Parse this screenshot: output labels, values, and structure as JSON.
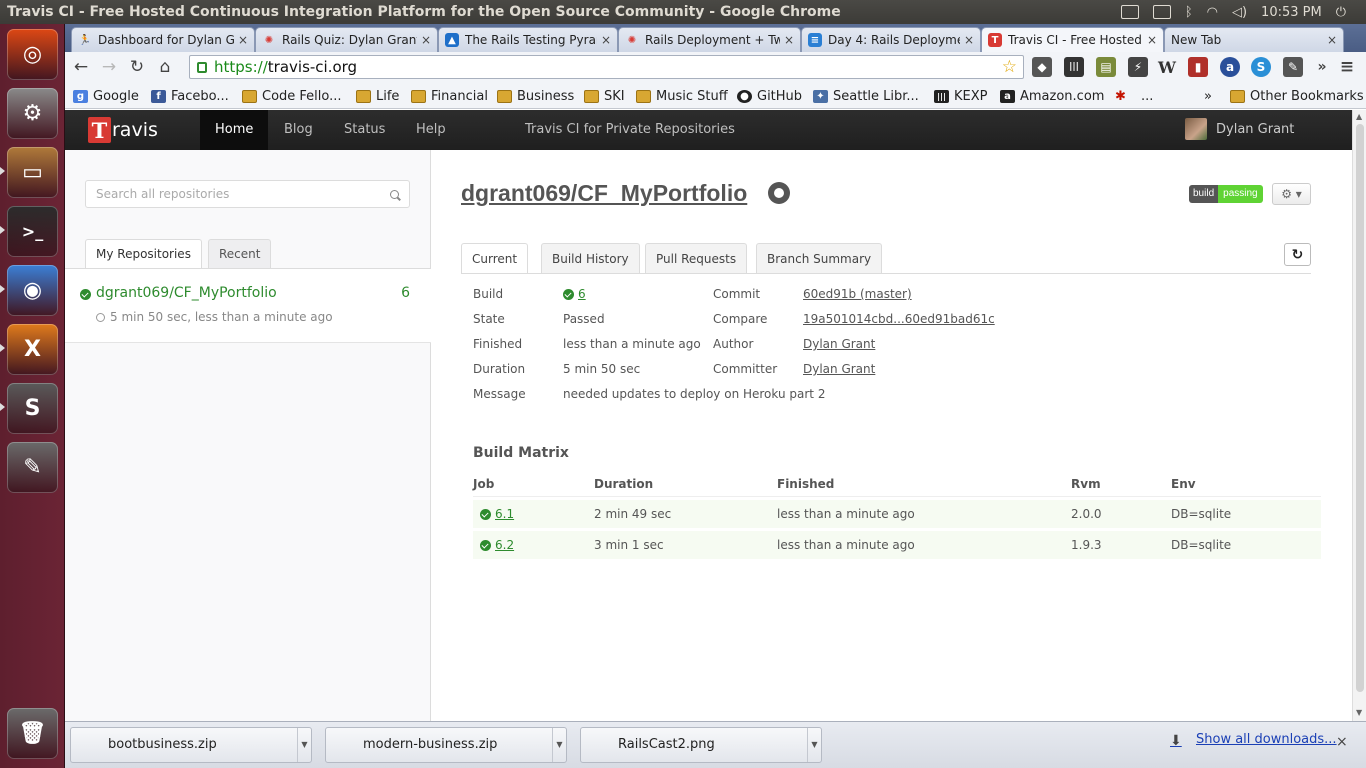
{
  "os": {
    "window_title": "Travis CI - Free Hosted Continuous Integration Platform for the Open Source Community - Google Chrome",
    "clock": "10:53 PM",
    "tray_icons": [
      "mail-icon",
      "keyboard-icon",
      "bluetooth-icon",
      "wifi-icon",
      "volume-icon",
      "power-icon"
    ]
  },
  "launcher": {
    "items": [
      {
        "name": "ubuntu-dash",
        "color": "#dd4814",
        "glyph": "◎"
      },
      {
        "name": "system-settings",
        "color": "#8a8a8a",
        "glyph": "⚙"
      },
      {
        "name": "files",
        "color": "#b07a3a",
        "glyph": "▭"
      },
      {
        "name": "terminal",
        "color": "#2c2c2c",
        "glyph": ">_"
      },
      {
        "name": "chrome",
        "color": "#3b7fd6",
        "glyph": "◉"
      },
      {
        "name": "xchat",
        "color": "#e07b1c",
        "glyph": "X"
      },
      {
        "name": "sublime-text",
        "color": "#5a5a5a",
        "glyph": "S"
      },
      {
        "name": "text-editor",
        "color": "#6a6a6a",
        "glyph": "✎"
      },
      {
        "name": "trash",
        "color": "#6b6b6b",
        "glyph": "🗑"
      }
    ]
  },
  "browser": {
    "tabs": [
      {
        "label": "Dashboard for Dylan G",
        "icon_color": "#d83a34",
        "icon_glyph": "🏃"
      },
      {
        "label": "Rails Quiz: Dylan Grant",
        "icon_color": "#d83a34",
        "icon_glyph": "✺"
      },
      {
        "label": "The Rails Testing Pyram",
        "icon_color": "#1e6fc9",
        "icon_glyph": "▲"
      },
      {
        "label": "Rails Deployment + Twi",
        "icon_color": "#d83a34",
        "icon_glyph": "✺"
      },
      {
        "label": "Day 4: Rails Deploymen",
        "icon_color": "#2a7fd4",
        "icon_glyph": "≡"
      },
      {
        "label": "Travis CI - Free Hosted",
        "icon_color": "#d83a34",
        "icon_glyph": "T"
      },
      {
        "label": "New Tab",
        "icon_color": "",
        "icon_glyph": ""
      }
    ],
    "close_glyph": "×",
    "nav": {
      "back": "←",
      "forward": "→",
      "reload": "↻",
      "home": "⌂"
    },
    "url_protocol": "https://",
    "url_host": "travis-ci.org",
    "star_glyph": "☆",
    "extensions": [
      {
        "name": "extension-a-icon",
        "color": "#555555",
        "glyph": "◆"
      },
      {
        "name": "extension-b-icon",
        "color": "#333333",
        "glyph": "|||"
      },
      {
        "name": "extension-c-icon",
        "color": "#7a8a3a",
        "glyph": "▤"
      },
      {
        "name": "extension-d-icon",
        "color": "#444444",
        "glyph": "⚡"
      },
      {
        "name": "wikipedia-icon",
        "color": "#777777",
        "glyph": "W"
      },
      {
        "name": "extension-e-icon",
        "color": "#b0302a",
        "glyph": "▮"
      },
      {
        "name": "extension-f-icon",
        "color": "#2a4f9a",
        "glyph": "a"
      },
      {
        "name": "skype-icon",
        "color": "#2a8fd6",
        "glyph": "S"
      },
      {
        "name": "extension-g-icon",
        "color": "#555555",
        "glyph": "✎"
      }
    ],
    "menu_glyph": "≡",
    "bookmarks": [
      {
        "label": "Google",
        "icon": "google",
        "color": "#4a7fe0",
        "glyph": "g"
      },
      {
        "label": "Facebo...",
        "icon": "facebook",
        "color": "#3b5998",
        "glyph": "f"
      },
      {
        "label": "Code Fello...",
        "icon": "folder",
        "color": "",
        "glyph": ""
      },
      {
        "label": "Life",
        "icon": "folder",
        "color": "",
        "glyph": ""
      },
      {
        "label": "Financial",
        "icon": "folder",
        "color": "",
        "glyph": ""
      },
      {
        "label": "Business",
        "icon": "folder",
        "color": "",
        "glyph": ""
      },
      {
        "label": "SKI",
        "icon": "folder",
        "color": "",
        "glyph": ""
      },
      {
        "label": "Music Stuff",
        "icon": "folder",
        "color": "",
        "glyph": ""
      },
      {
        "label": "GitHub",
        "icon": "github",
        "color": "#222222",
        "glyph": "●"
      },
      {
        "label": "Seattle Libr...",
        "icon": "library",
        "color": "#4a6fa5",
        "glyph": "✦"
      },
      {
        "label": "KEXP",
        "icon": "kexp",
        "color": "#222222",
        "glyph": "|||"
      },
      {
        "label": "Amazon.com",
        "icon": "amazon",
        "color": "#222222",
        "glyph": "a"
      },
      {
        "label": "...",
        "icon": "yelp",
        "color": "#c41200",
        "glyph": "✱"
      }
    ],
    "bookmarks_overflow": "»",
    "other_bookmarks": "Other Bookmarks"
  },
  "travis": {
    "brand": "ravis",
    "brand_letter": "T",
    "nav": [
      "Home",
      "Blog",
      "Status",
      "Help",
      "Travis CI for Private Repositories"
    ],
    "user": "Dylan Grant",
    "search_placeholder": "Search all repositories",
    "left_tabs": [
      "My Repositories",
      "Recent"
    ],
    "repos": [
      {
        "name": "dgrant069/CF_MyPortfolio",
        "build": "6",
        "time": "5 min 50 sec, less than a minute ago"
      }
    ],
    "repo_title": "dgrant069/CF_MyPortfolio",
    "badge": {
      "left": "build",
      "right": "passing"
    },
    "settings_glyph": "⚙ ▾",
    "tabs": [
      "Current",
      "Build History",
      "Pull Requests",
      "Branch Summary"
    ],
    "reload_glyph": "↻",
    "summary": {
      "build_label": "Build",
      "build_value": "6",
      "state_label": "State",
      "state_value": "Passed",
      "finished_label": "Finished",
      "finished_value": "less than a minute ago",
      "duration_label": "Duration",
      "duration_value": "5 min 50 sec",
      "message_label": "Message",
      "message_value": "needed updates to deploy on Heroku part 2",
      "commit_label": "Commit",
      "commit_value": "60ed91b (master)",
      "compare_label": "Compare",
      "compare_value": "19a501014cbd...60ed91bad61c",
      "author_label": "Author",
      "author_value": "Dylan Grant",
      "committer_label": "Committer",
      "committer_value": "Dylan Grant"
    },
    "matrix": {
      "title": "Build Matrix",
      "headers": [
        "Job",
        "Duration",
        "Finished",
        "Rvm",
        "Env"
      ],
      "rows": [
        {
          "job": "6.1",
          "duration": "2 min 49 sec",
          "finished": "less than a minute ago",
          "rvm": "2.0.0",
          "env": "DB=sqlite"
        },
        {
          "job": "6.2",
          "duration": "3 min 1 sec",
          "finished": "less than a minute ago",
          "rvm": "1.9.3",
          "env": "DB=sqlite"
        }
      ]
    }
  },
  "downloads": {
    "items": [
      "bootbusiness.zip",
      "modern-business.zip",
      "RailsCast2.png"
    ],
    "show_all": "Show all downloads...",
    "close": "×"
  }
}
